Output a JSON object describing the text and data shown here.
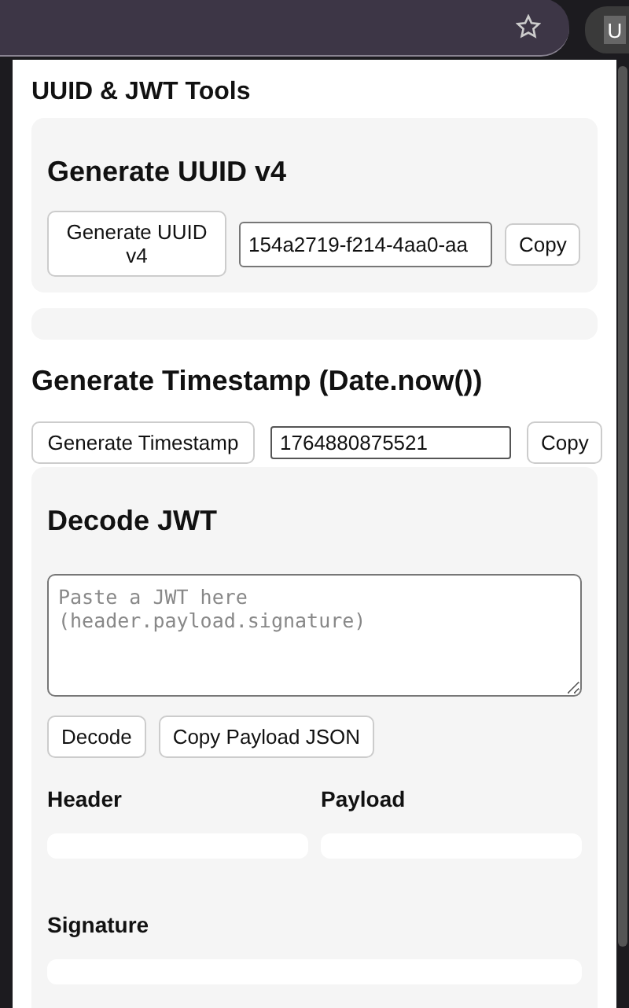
{
  "browser": {
    "profile_initial": "U"
  },
  "popup": {
    "title": "UUID & JWT Tools",
    "uuid": {
      "heading": "Generate UUID v4",
      "generate_button": "Generate UUID v4",
      "value": "154a2719-f214-4aa0-aa",
      "copy_button": "Copy"
    },
    "timestamp": {
      "heading": "Generate Timestamp (Date.now())",
      "generate_button": "Generate Timestamp",
      "value": "1764880875521",
      "copy_button": "Copy"
    },
    "jwt": {
      "heading": "Decode JWT",
      "placeholder": "Paste a JWT here\n(header.payload.signature)",
      "decode_button": "Decode",
      "copy_payload_button": "Copy Payload JSON",
      "header_label": "Header",
      "payload_label": "Payload",
      "signature_label": "Signature"
    }
  }
}
